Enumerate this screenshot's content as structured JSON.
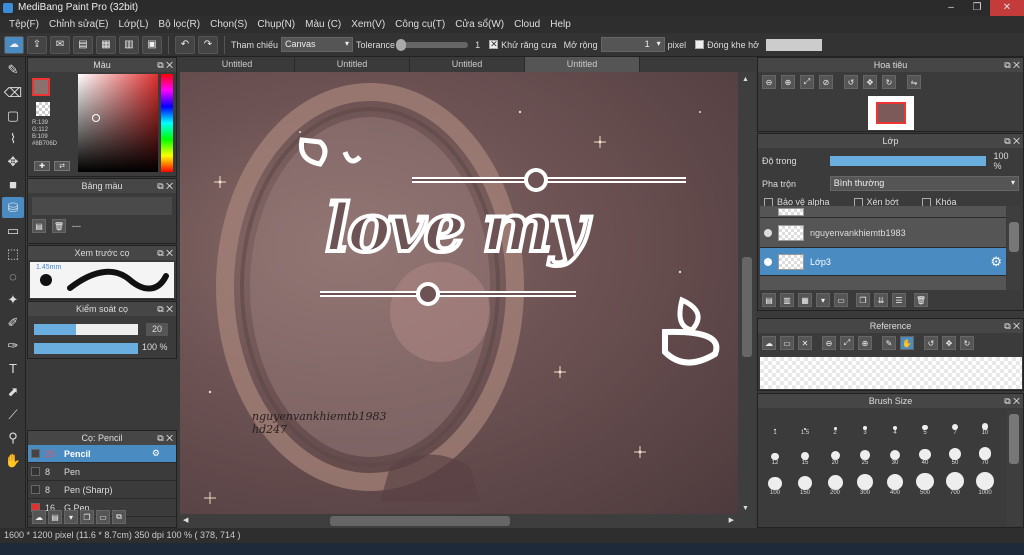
{
  "app": {
    "title": "MediBang Paint Pro (32bit)"
  },
  "menu": [
    "Tệp(F)",
    "Chỉnh sửa(E)",
    "Lớp(L)",
    "Bộ lọc(R)",
    "Chọn(S)",
    "Chụp(N)",
    "Màu (C)",
    "Xem(V)",
    "Công cụ(T)",
    "Cửa sổ(W)",
    "Cloud",
    "Help"
  ],
  "toolbar": {
    "ref_label": "Tham chiếu",
    "ref_value": "Canvas",
    "tolerance_label": "Tolerance",
    "tolerance_value": "1",
    "antialias_label": "Khử răng cưa",
    "expand_label": "Mở rộng",
    "expand_value": "1",
    "expand_unit": "pixel",
    "gap_label": "Đóng khe hở",
    "tolerance_level": 0.02
  },
  "color_panel": {
    "title": "Màu",
    "r": "R:139",
    "g": "G:112",
    "b": "B:109",
    "hex": "#8B706D",
    "main_color": "#8B706D"
  },
  "palette_panel": {
    "title": "Bảng màu",
    "entry": "---"
  },
  "brush_preview": {
    "title": "Xem trước cọ",
    "size": "1.45mm"
  },
  "brush_control": {
    "title": "Kiểm soát cọ",
    "size": "20",
    "opacity": "100 %",
    "size_fraction": 0.4,
    "opacity_fraction": 1.0
  },
  "brush_list": {
    "title": "Cọ: Pencil",
    "items": [
      {
        "size": "20",
        "name": "Pencil",
        "color": "#ffffff"
      },
      {
        "size": "8",
        "name": "Pen",
        "color": "#333333"
      },
      {
        "size": "8",
        "name": "Pen (Sharp)",
        "color": "#333333"
      },
      {
        "size": "16",
        "name": "G Pen",
        "color": "#e03030"
      }
    ]
  },
  "tabs": [
    "Untitled",
    "Untitled",
    "Untitled",
    "Untitled"
  ],
  "canvas": {
    "line1": "nguyenvankhiemtb1983",
    "line2": "hd247",
    "art_text": "love my"
  },
  "navigator": {
    "title": "Hoa tiêu"
  },
  "layer_panel": {
    "title": "Lớp",
    "opacity_label": "Độ trong",
    "opacity_value": "100 %",
    "opacity_fraction": 1.0,
    "blend_label": "Pha trộn",
    "blend_value": "Bình thường",
    "protect_alpha": "Bảo vệ alpha",
    "clipping": "Xén bớt",
    "lock": "Khóa",
    "layers": [
      {
        "name": "nguyenvankhiemtb1983"
      },
      {
        "name": "Lớp3"
      }
    ]
  },
  "reference_panel": {
    "title": "Reference"
  },
  "brush_size_panel": {
    "title": "Brush Size",
    "sizes": [
      "1",
      "1.5",
      "2",
      "3",
      "4",
      "5",
      "7",
      "10",
      "12",
      "15",
      "20",
      "25",
      "30",
      "40",
      "50",
      "70",
      "100",
      "150",
      "200",
      "300",
      "400",
      "500",
      "700",
      "1000"
    ]
  },
  "status": {
    "text": "1600 * 1200 pixel   (11.6 * 8.7cm)   350 dpi   100 %   ( 378, 714 )"
  }
}
